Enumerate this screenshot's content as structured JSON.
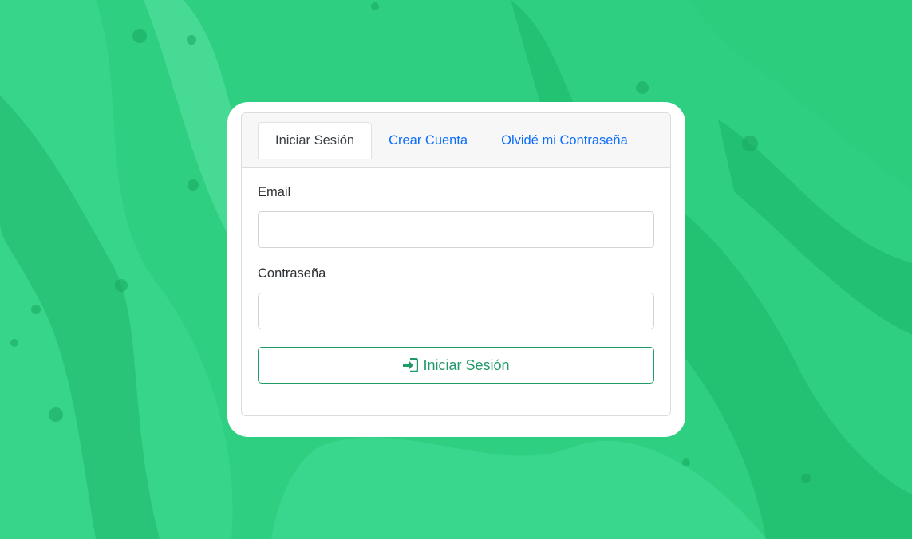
{
  "tabs": [
    {
      "label": "Iniciar Sesión",
      "active": true
    },
    {
      "label": "Crear Cuenta",
      "active": false
    },
    {
      "label": "Olvidé mi Contraseña",
      "active": false
    }
  ],
  "form": {
    "email_label": "Email",
    "email_value": "",
    "password_label": "Contraseña",
    "password_value": "",
    "submit_label": "Iniciar Sesión",
    "submit_icon": "sign-in-icon"
  },
  "colors": {
    "background": "#2fcf82",
    "accent": "#1f9a66",
    "link": "#0d6efd"
  }
}
